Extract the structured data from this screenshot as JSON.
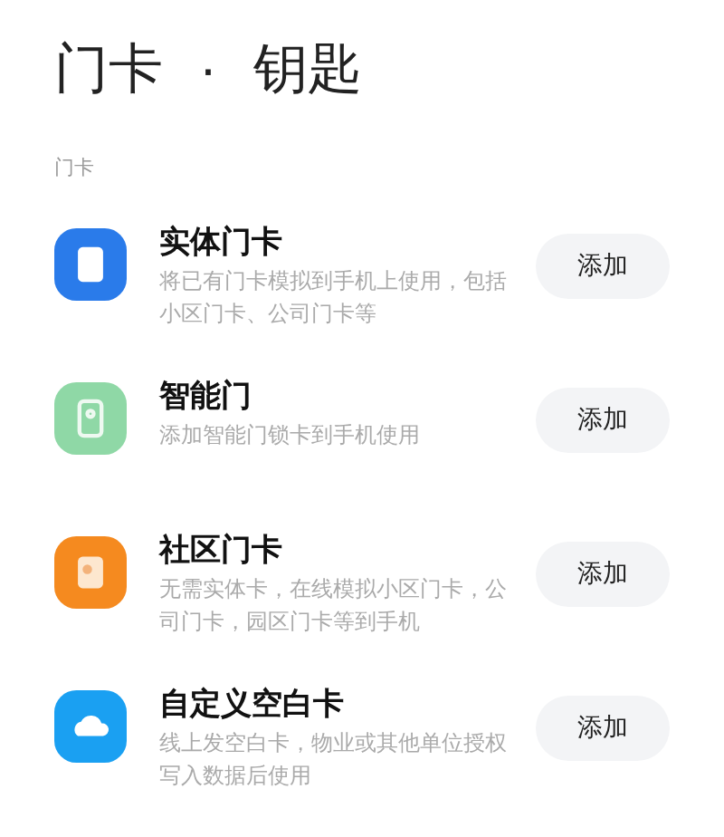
{
  "header": {
    "title": "门卡",
    "separator": "·",
    "subtitle": "钥匙"
  },
  "section": {
    "label": "门卡"
  },
  "items": [
    {
      "kind": "card",
      "color": "#2a7bea",
      "title": "实体门卡",
      "description": "将已有门卡模拟到手机上使用，包括小区门卡、公司门卡等",
      "button": "添加"
    },
    {
      "kind": "lock",
      "color": "#8fd8a6",
      "title": "智能门",
      "description": "添加智能门锁卡到手机使用",
      "button": "添加"
    },
    {
      "kind": "community",
      "color": "#f58a1f",
      "title": "社区门卡",
      "description": "无需实体卡，在线模拟小区门卡，公司门卡，园区门卡等到手机",
      "button": "添加"
    },
    {
      "kind": "cloud",
      "color": "#1aa0f2",
      "title": "自定义空白卡",
      "description": "线上发空白卡，物业或其他单位授权写入数据后使用",
      "button": "添加"
    }
  ]
}
